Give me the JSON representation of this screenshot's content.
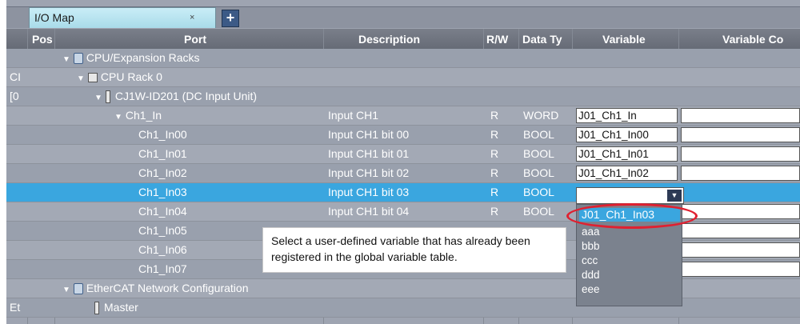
{
  "tab": {
    "label": "I/O Map",
    "close": "×",
    "add": "+"
  },
  "columns": [
    "Pos",
    "Port",
    "Description",
    "R/W",
    "Data Ty",
    "Variable",
    "Variable Co"
  ],
  "rows": [
    {
      "pos": "",
      "port": "CPU/Expansion Racks",
      "desc": "",
      "rw": "",
      "type": "",
      "var": ""
    },
    {
      "pos": "CI",
      "port": "CPU Rack 0",
      "desc": "",
      "rw": "",
      "type": "",
      "var": ""
    },
    {
      "pos": "[0",
      "port": "CJ1W-ID201 (DC Input Unit)",
      "desc": "",
      "rw": "",
      "type": "",
      "var": ""
    },
    {
      "pos": "",
      "port": "Ch1_In",
      "desc": "Input CH1",
      "rw": "R",
      "type": "WORD",
      "var": "J01_Ch1_In"
    },
    {
      "pos": "",
      "port": "Ch1_In00",
      "desc": "Input CH1 bit 00",
      "rw": "R",
      "type": "BOOL",
      "var": "J01_Ch1_In00"
    },
    {
      "pos": "",
      "port": "Ch1_In01",
      "desc": "Input CH1 bit 01",
      "rw": "R",
      "type": "BOOL",
      "var": "J01_Ch1_In01"
    },
    {
      "pos": "",
      "port": "Ch1_In02",
      "desc": "Input CH1 bit 02",
      "rw": "R",
      "type": "BOOL",
      "var": "J01_Ch1_In02"
    },
    {
      "pos": "",
      "port": "Ch1_In03",
      "desc": "Input CH1 bit 03",
      "rw": "R",
      "type": "BOOL",
      "var": ""
    },
    {
      "pos": "",
      "port": "Ch1_In04",
      "desc": "Input CH1 bit 04",
      "rw": "R",
      "type": "BOOL",
      "var": ""
    },
    {
      "pos": "",
      "port": "Ch1_In05",
      "desc": "",
      "rw": "",
      "type": "",
      "var": ""
    },
    {
      "pos": "",
      "port": "Ch1_In06",
      "desc": "",
      "rw": "",
      "type": "",
      "var": ""
    },
    {
      "pos": "",
      "port": "Ch1_In07",
      "desc": "",
      "rw": "",
      "type": "",
      "var": ""
    },
    {
      "pos": "",
      "port": "EtherCAT Network Configuration",
      "desc": "",
      "rw": "",
      "type": "",
      "var": ""
    },
    {
      "pos": "Et",
      "port": "Master",
      "desc": "",
      "rw": "",
      "type": "",
      "var": ""
    }
  ],
  "dropdown": {
    "options": [
      "J01_Ch1_In03",
      "aaa",
      "bbb",
      "ccc",
      "ddd",
      "eee"
    ],
    "arrow": "▼"
  },
  "callout": {
    "text": "Select a user-defined variable that has already been registered in the global variable table."
  },
  "colors": {
    "selected_row": "#3aa6df",
    "highlight_ring": "#e02030",
    "header": "#6d727d"
  }
}
